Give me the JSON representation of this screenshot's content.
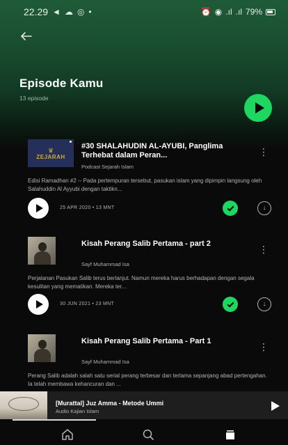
{
  "status_bar": {
    "time": "22.29",
    "signal_text": ".ıl",
    "battery": "79%"
  },
  "page": {
    "title": "Episode Kamu",
    "subtitle": "13 episode"
  },
  "episodes": [
    {
      "title": "#30 SHALAHUDIN AL-AYUBI, Panglima Terhebat dalam Peran...",
      "publisher": "Podcast Sejarah Islam",
      "description": "Edisi Ramadhan #2 -- Pada pertempuran tersebut, pasukan islam yang dipimpin langsung oleh Salahuddin Al Ayyubi dengan taktikn...",
      "meta": "25 APR 2020 • 13 MNT",
      "thumb_text": "ZEJARAH",
      "completed": true
    },
    {
      "title": "Kisah Perang Salib Pertama - part 2",
      "publisher": "Sayf Muhammad Isa",
      "description": "Perjalanan Pasukan Salib terus berlanjut. Namun mereka harus berhadapan dengan segala kesulitan yang mematikan. Mereka ter...",
      "meta": "30 JUN 2021 • 23 MNT",
      "completed": true
    },
    {
      "title": "Kisah Perang Salib Pertama - Part 1",
      "publisher": "Sayf Muhammad Isa",
      "description": "Perang Salib adalah salah satu serial perang terbesar dan terlama sepanjang abad pertengahan. Ia telah membawa kehancuran dan ..."
    }
  ],
  "mini_player": {
    "title": "[Murattal] Juz Amma - Metode Ummi",
    "subtitle": "Audio Kajian Islam"
  },
  "colors": {
    "accent_green": "#1ed760",
    "header_green": "#1f5b38",
    "background": "#0a0a0a"
  },
  "icons": {
    "back": "arrow-left-icon",
    "play": "play-icon",
    "check": "check-circle-icon",
    "download": "download-icon",
    "more": "more-vertical-icon",
    "home": "home-icon",
    "search": "search-icon",
    "library": "library-icon"
  }
}
